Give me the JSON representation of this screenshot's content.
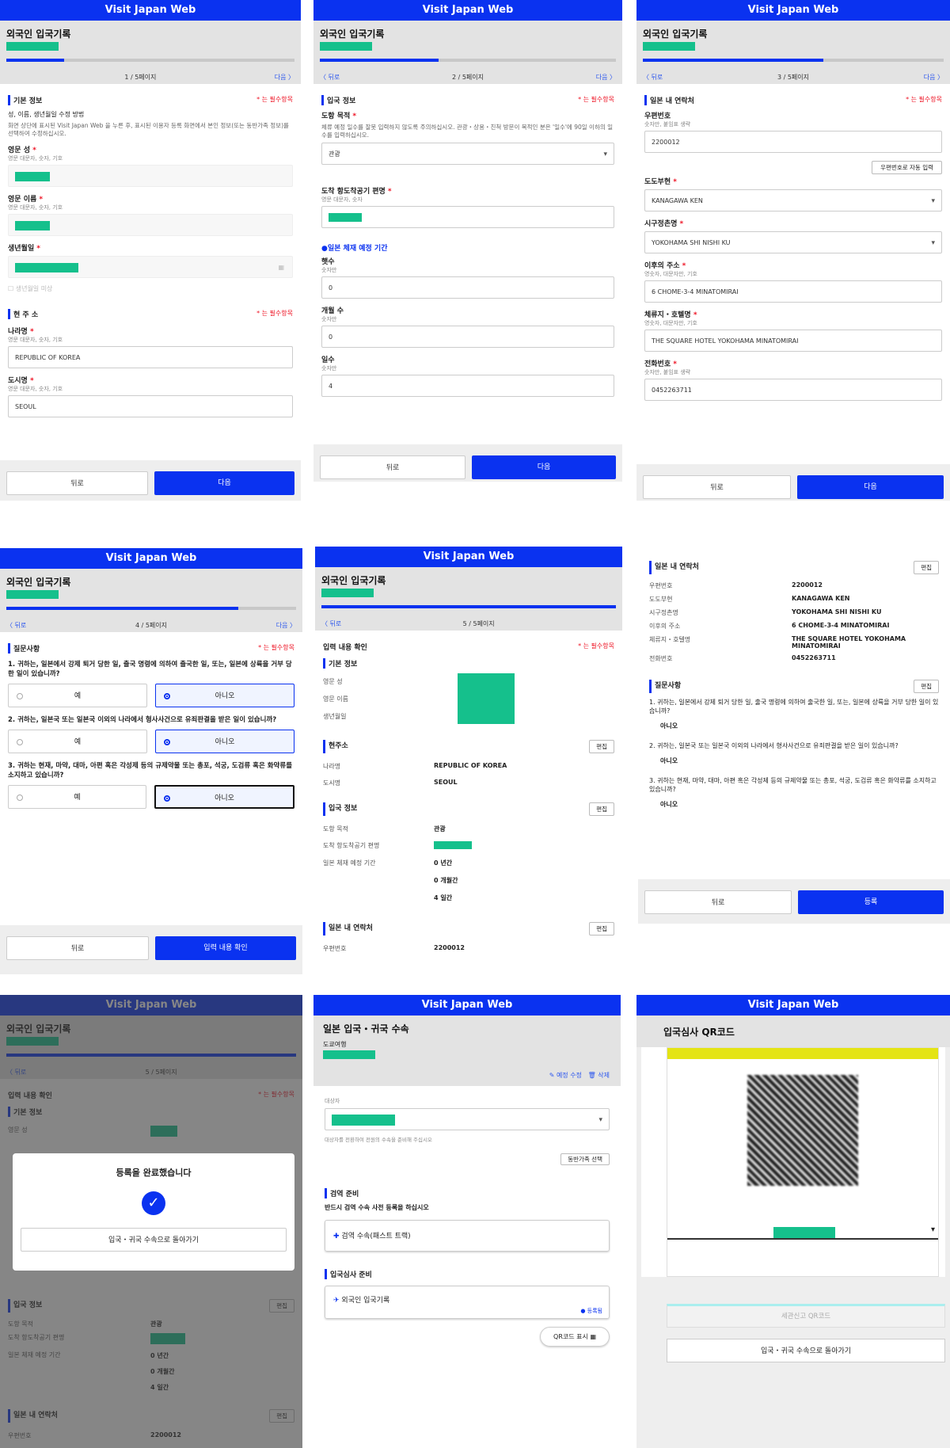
{
  "app": {
    "title": "Visit Japan Web",
    "form_title": "외국인 입국기록",
    "required_note": "* 는 필수항목",
    "back": "뒤로",
    "next": "다음",
    "back_link": "〈 뒤로",
    "next_link": "다음 〉",
    "edit": "편집"
  },
  "s1": {
    "page": "1 / 5페이지",
    "sec1": "기본 정보",
    "desc": "성, 이름, 생년월일 수정 방법",
    "desc2": "화면 상단에 표시된 Visit Japan Web 을 누른 후, 표시된 이용자 등록 화면에서 본인 정보(또는 동반가족 정보)를 선택하여 수정하십시오.",
    "surname": "영문 성",
    "surname_hint": "영문 대문자, 숫자, 기호",
    "given": "영문 이름",
    "given_hint": "영문 대문자, 숫자, 기호",
    "dob": "생년월일",
    "unknown": "생년월일 미상",
    "sec2": "현 주 소",
    "country": "나라명",
    "country_hint": "영문 대문자, 숫자, 기호",
    "country_val": "REPUBLIC OF KOREA",
    "city": "도시명",
    "city_hint": "영문 대문자, 숫자, 기호",
    "city_val": "SEOUL"
  },
  "s2": {
    "page": "2 / 5페이지",
    "sec": "입국 정보",
    "purpose": "도항 목적",
    "purpose_note": "체류 예정 일수를 잘못 입력하지 않도록 주의하십시오. 관광・상용・친척 방문이 목적인 분은 '일수'에 90일 이하의 일수를 입력하십시오.",
    "purpose_val": "관광",
    "flight": "도착 항도착공기 편명",
    "flight_hint": "영문 대문자, 숫자",
    "stay": "●일본 체재 예정 기간",
    "years": "햇수",
    "months": "개월 수",
    "days": "일수",
    "num_hint": "숫자만",
    "years_val": "0",
    "months_val": "0",
    "days_val": "4"
  },
  "s3": {
    "page": "3 / 5페이지",
    "sec": "일본 내 연락처",
    "postal": "우편번호",
    "postal_hint": "숫자만, 붙임표 생략",
    "postal_val": "2200012",
    "auto": "우편번호로 자동 입력",
    "pref": "도도부현",
    "pref_val": "KANAGAWA KEN",
    "city": "시구정촌명",
    "city_val": "YOKOHAMA SHI NISHI KU",
    "addr": "이후의 주소",
    "addr_hint": "영숫자, 대문자만, 기호",
    "addr_val": "6 CHOME-3-4 MINATOMIRAI",
    "hotel": "체류지・호텔명",
    "hotel_hint": "영숫자, 대문자만, 기호",
    "hotel_val": "THE SQUARE HOTEL YOKOHAMA MINATOMIRAI",
    "phone": "전화번호",
    "phone_hint": "숫자만, 붙임표 생략",
    "phone_val": "0452263711"
  },
  "s4": {
    "page": "4 / 5페이지",
    "sec": "질문사항",
    "q1": "1. 귀하는, 일본에서 강제 퇴거 당한 일, 출국 명령에 의하여 출국한 일, 또는, 일본에 상륙을 거부 당한 일이 있습니까?",
    "q2": "2. 귀하는, 일본국 또는 일본국 이외의 나라에서 형사사건으로 유죄판결을 받은 일이 있습니까?",
    "q3": "3. 귀하는 현재, 마약, 대마, 아편 혹은 각성제 등의 규제약물 또는 총포, 석궁, 도검류 혹은 화약류를 소지하고 있습니까?",
    "yes": "예",
    "no": "아니오",
    "confirm": "입력 내용 확인"
  },
  "s5": {
    "page": "5 / 5페이지",
    "heading": "입력 내용 확인",
    "basic": "기본 정보",
    "surname": "영문 성",
    "given": "영문 이름",
    "dob": "생년월일",
    "addr": "현주소",
    "country": "나라명",
    "country_val": "REPUBLIC OF KOREA",
    "city": "도시명",
    "city_val": "SEOUL",
    "entry": "입국 정보",
    "purpose": "도항 목적",
    "purpose_val": "관광",
    "flight": "도착 항도착공기 편명",
    "stay": "일본 체재 예정 기간",
    "y": "0 년간",
    "m": "0 개월간",
    "d": "4 일간",
    "contact": "일본 내 연락처",
    "postal": "우편번호",
    "postal_val": "2200012"
  },
  "s6": {
    "contact": "일본 내 연락처",
    "postal": "우편번호",
    "postal_val": "2200012",
    "pref": "도도부현",
    "pref_val": "KANAGAWA KEN",
    "city": "시구정촌명",
    "city_val": "YOKOHAMA SHI NISHI KU",
    "addr": "이후의 주소",
    "addr_val": "6 CHOME-3-4 MINATOMIRAI",
    "hotel": "체류지・호텔명",
    "hotel_val": "THE SQUARE HOTEL YOKOHAMA MINATOMIRAI",
    "phone": "전화번호",
    "phone_val": "0452263711",
    "qs": "질문사항",
    "q1": "1. 귀하는, 일본에서 강제 퇴거 당한 일, 출국 명령에 의하여 출국한 일, 또는, 일본에 상륙을 거부 당한 일이 있습니까?",
    "q2": "2. 귀하는, 일본국 또는 일본국 이외의 나라에서 형사사건으로 유죄판결을 받은 일이 있습니까?",
    "q3": "3. 귀하는 현재, 마약, 대마, 아편 혹은 각성제 등의 규제약물 또는 총포, 석궁, 도검류 혹은 화약류를 소지하고 있습니까?",
    "a": "아니오",
    "register": "등록"
  },
  "s7": {
    "done": "등록을 완료했습니다",
    "return": "입국・귀국 수속으로 돌아가기"
  },
  "s8": {
    "title": "일본 입국・귀국 수속",
    "trip": "도쿄여행",
    "edit_plan": "예정 수정",
    "delete": "삭제",
    "target": "대상자",
    "target_note": "대상자를 전환하여 전원의 수속을 준비해 주십시오",
    "family": "동반가족 선택",
    "quarantine": "검역 준비",
    "quarantine_note": "반드시 검역 수속 사전 등록을 하십시오",
    "fast_track": "검역 수속(패스트 트랙)",
    "immigration": "입국심사 준비",
    "record": "외국인 입국기록",
    "registered": "등록됨",
    "qr": "QR코드 표시"
  },
  "s9": {
    "title": "입국심사 QR코드",
    "customs": "세관신고 QR코드",
    "return": "입국・귀국 수속으로 돌아가기"
  }
}
